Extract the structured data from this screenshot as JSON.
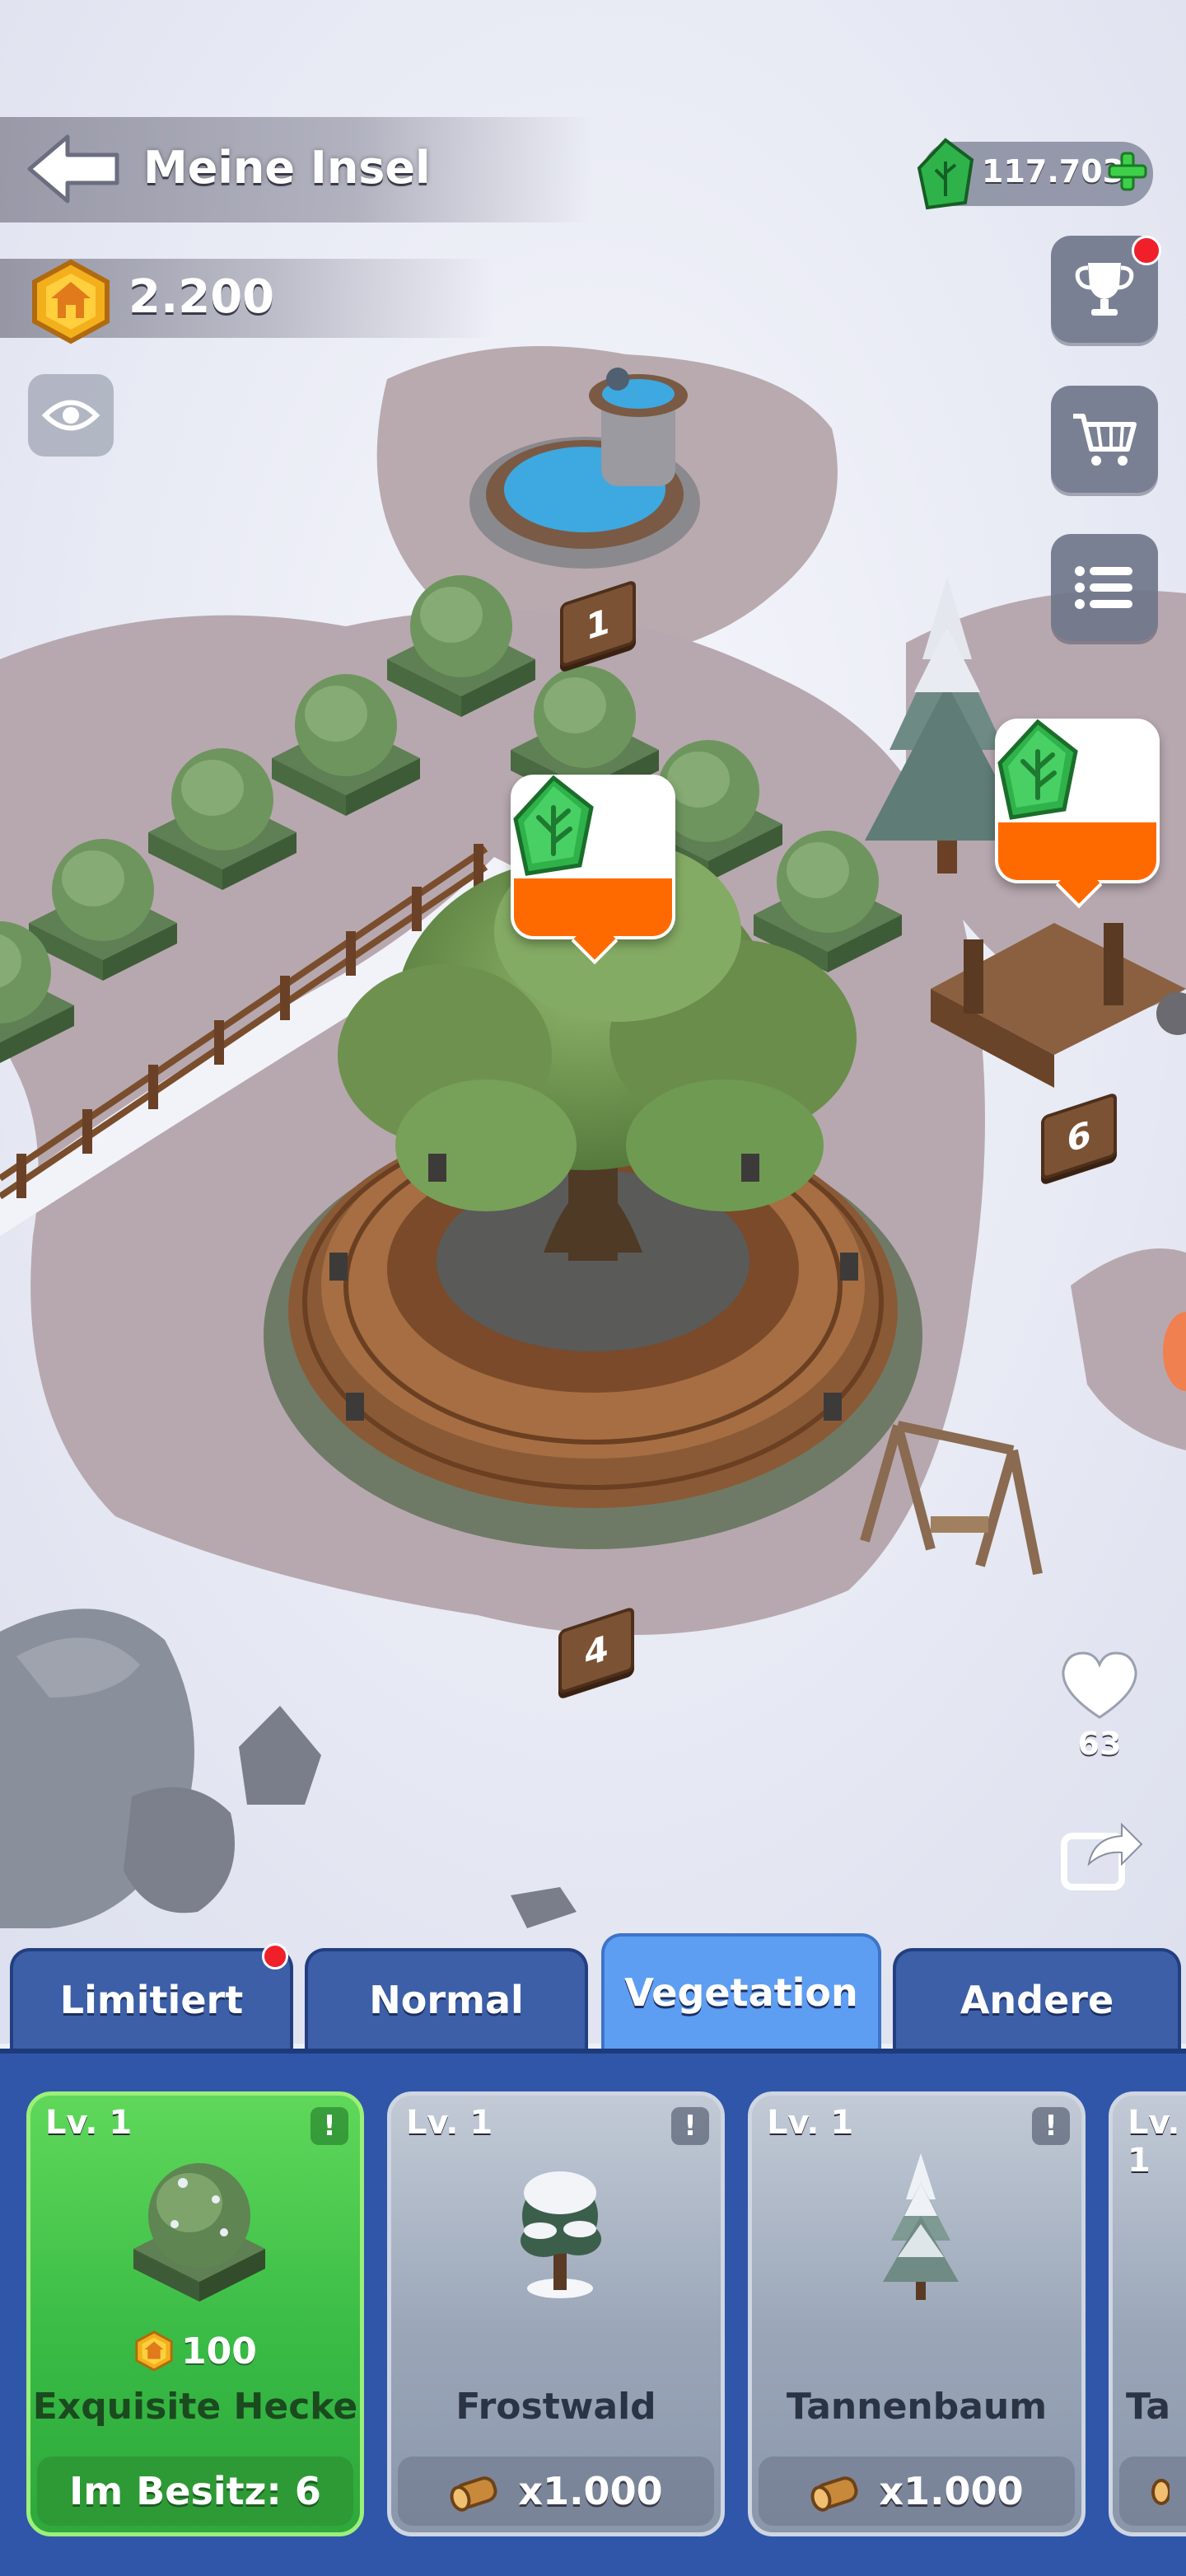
{
  "header": {
    "title": "Meine Insel",
    "coins": "2.200",
    "gems": "117.703"
  },
  "map": {
    "plot_numbers": [
      "1",
      "4",
      "6"
    ]
  },
  "social": {
    "likes": "63"
  },
  "tabs": [
    {
      "label": "Limitiert",
      "notify": true
    },
    {
      "label": "Normal"
    },
    {
      "label": "Vegetation",
      "active": true
    },
    {
      "label": "Andere"
    }
  ],
  "items": [
    {
      "level": "Lv. 1",
      "info": "!",
      "price": "100",
      "name": "Exquisite Hecke",
      "footer": "Im Besitz: 6",
      "selected": true
    },
    {
      "level": "Lv. 1",
      "info": "!",
      "name": "Frostwald",
      "footer": "x1.000"
    },
    {
      "level": "Lv. 1",
      "info": "!",
      "name": "Tannenbaum",
      "footer": "x1.000"
    },
    {
      "level": "Lv. 1",
      "name": "Ta"
    }
  ],
  "colors": {
    "accent_orange": "#ff6a00",
    "gem_green": "#2fb24a",
    "panel_blue": "#2f56a8",
    "active_tab": "#5e9ef2"
  }
}
